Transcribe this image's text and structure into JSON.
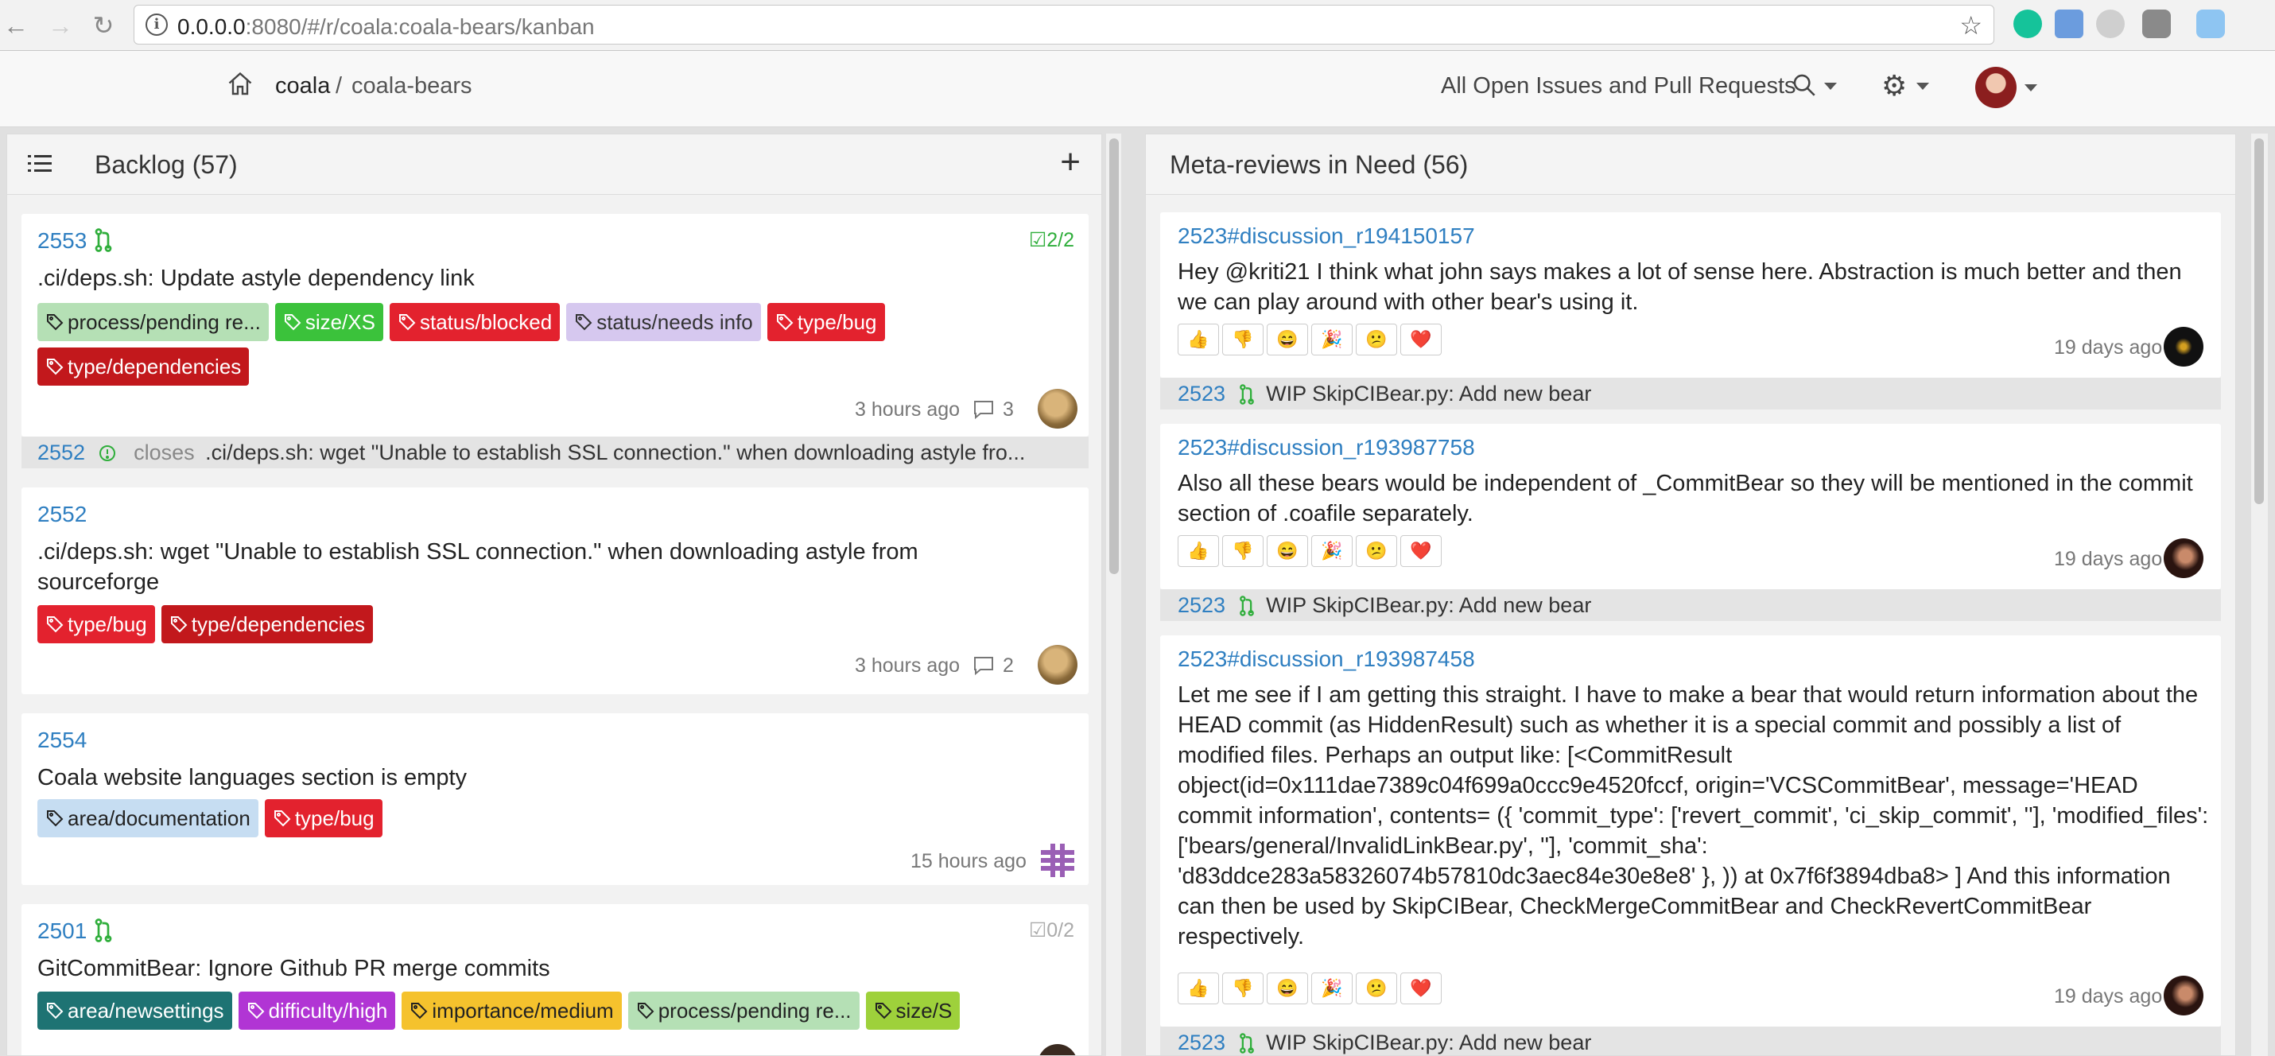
{
  "browser": {
    "url_host": "0.0.0.0",
    "url_rest": ":8080/#/r/coala:coala-bears/kanban"
  },
  "header": {
    "breadcrumb": {
      "org": "coala",
      "separator": "/",
      "repo": "coala-bears"
    },
    "filter_label": "All Open Issues and Pull Requests"
  },
  "backlog": {
    "title": "Backlog (57)",
    "cards": [
      {
        "number": "2553",
        "checks": "2/2",
        "title": ".ci/deps.sh: Update astyle dependency link",
        "labels": [
          {
            "text": "process/pending re...",
            "bg": "#b5e0b5",
            "fg": "#222"
          },
          {
            "text": "size/XS",
            "bg": "#3bc23b",
            "fg": "#fff"
          },
          {
            "text": "status/blocked",
            "bg": "#e3222e",
            "fg": "#fff"
          },
          {
            "text": "status/needs info",
            "bg": "#d6c8ef",
            "fg": "#333"
          },
          {
            "text": "type/bug",
            "bg": "#e3222e",
            "fg": "#fff"
          },
          {
            "text": "type/dependencies",
            "bg": "#c2181c",
            "fg": "#fff"
          }
        ],
        "time": "3 hours ago",
        "comments": "3"
      },
      {
        "number": "2552",
        "title": ".ci/deps.sh: wget \"Unable to establish SSL connection.\" when downloading astyle from sourceforge",
        "labels": [
          {
            "text": "type/bug",
            "bg": "#e3222e",
            "fg": "#fff"
          },
          {
            "text": "type/dependencies",
            "bg": "#c2181c",
            "fg": "#fff"
          }
        ],
        "time": "3 hours ago",
        "comments": "2"
      },
      {
        "number": "2554",
        "title": "Coala website languages section is empty",
        "labels": [
          {
            "text": "area/documentation",
            "bg": "#c6ddf2",
            "fg": "#222"
          },
          {
            "text": "type/bug",
            "bg": "#e3222e",
            "fg": "#fff"
          }
        ],
        "time": "15 hours ago"
      },
      {
        "number": "2501",
        "checks": "0/2",
        "title": "GitCommitBear: Ignore Github PR merge commits",
        "labels": [
          {
            "text": "area/newsettings",
            "bg": "#1e7373",
            "fg": "#fff"
          },
          {
            "text": "difficulty/high",
            "bg": "#b135d4",
            "fg": "#fff"
          },
          {
            "text": "importance/medium",
            "bg": "#f5c22d",
            "fg": "#222"
          },
          {
            "text": "process/pending re...",
            "bg": "#b5e0b5",
            "fg": "#222"
          },
          {
            "text": "size/S",
            "bg": "#9ed13b",
            "fg": "#222"
          }
        ]
      }
    ],
    "linked_ref": {
      "number": "2552",
      "keyword": "closes",
      "text": ".ci/deps.sh: wget \"Unable to establish SSL connection.\" when downloading astyle fro..."
    }
  },
  "metareviews": {
    "title": "Meta-reviews in Need (56)",
    "reactions": [
      "👍",
      "👎",
      "😄",
      "🎉",
      "😕",
      "❤️"
    ],
    "items": [
      {
        "link": "2523#discussion_r194150157",
        "body": "Hey @kriti21 I think what john says makes a lot of sense here. Abstraction is much better and then we can play around with other bear's using it.",
        "time": "19 days ago",
        "ref_number": "2523",
        "ref_title": "WIP SkipCIBear.py: Add new bear"
      },
      {
        "link": "2523#discussion_r193987758",
        "body": "Also all these bears would be independent of _CommitBear so they will be mentioned in the commit section of .coafile separately.",
        "time": "19 days ago",
        "ref_number": "2523",
        "ref_title": "WIP SkipCIBear.py: Add new bear"
      },
      {
        "link": "2523#discussion_r193987458",
        "body": "Let me see if I am getting this straight. I have to make a bear that would return information about the HEAD commit (as HiddenResult) such as whether it is a special commit and possibly a list of modified files. Perhaps an output like: [<CommitResult object(id=0x111dae7389c04f699a0ccc9e4520fccf, origin='VCSCommitBear', message='HEAD commit information', contents= ({ 'commit_type': ['revert_commit', 'ci_skip_commit', ''], 'modified_files': ['bears/general/InvalidLinkBear.py', ''], 'commit_sha': 'd83ddce283a58326074b57810dc3aec84e30e8e8' }, )) at 0x7f6f3894dba8> ] And this information can then be used by SkipCIBear, CheckMergeCommitBear and CheckRevertCommitBear respectively.",
        "time": "19 days ago",
        "ref_number": "2523",
        "ref_title": "WIP SkipCIBear.py: Add new bear"
      }
    ]
  }
}
